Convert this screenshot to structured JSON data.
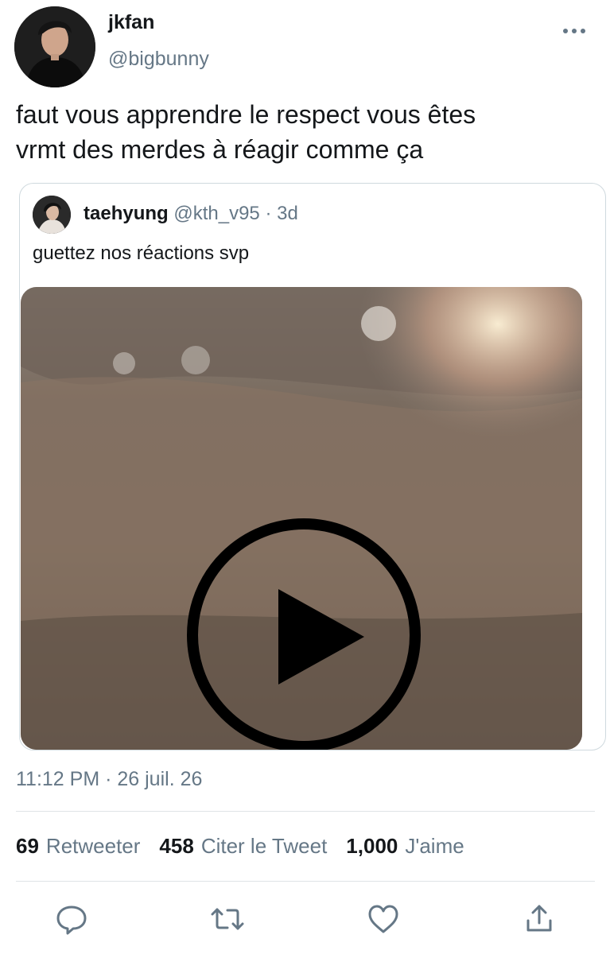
{
  "tweet": {
    "author": {
      "name": "jkfan",
      "handle": "@bigbunny"
    },
    "text_lines": [
      "faut vous apprendre le respect vous êtes",
      "vrmt des merdes à réagir comme ça"
    ],
    "timestamp": "11:12 PM · 26 juil. 26"
  },
  "quoted": {
    "name": "taehyung",
    "handle": "@kth_v95",
    "separator": "·",
    "time": "3d",
    "text": "guettez nos réactions svp"
  },
  "stats": [
    {
      "count": "69",
      "label": "Retweeter"
    },
    {
      "count": "458",
      "label": "Citer le Tweet"
    },
    {
      "count": "1,000",
      "label": "J'aime"
    }
  ],
  "icons": {
    "more": "more-horizontal-icon",
    "play": "play-icon",
    "reply": "reply-icon",
    "retweet": "retweet-icon",
    "like": "heart-icon",
    "share": "share-icon"
  },
  "colors": {
    "text": "#14171a",
    "secondary": "#657786",
    "border": "#cfd9de",
    "icon": "#657786"
  }
}
